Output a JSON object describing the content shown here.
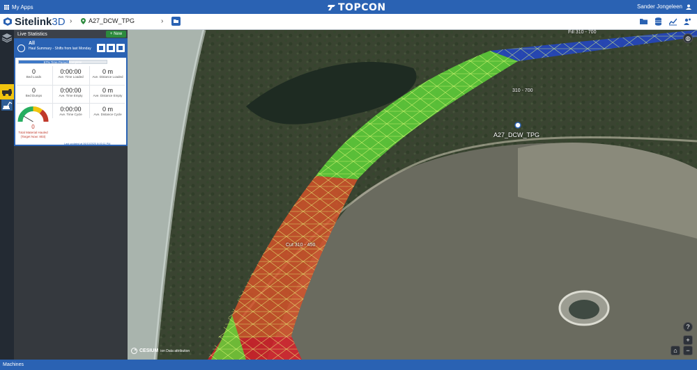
{
  "topbar": {
    "apps_label": "My Apps",
    "brand_logo": "TOPCON",
    "user_name": "Sander Jongeleen"
  },
  "navbar": {
    "app_name": "Sitelink",
    "app_name_suffix": "3D",
    "project_name": "A27_DCW_TPG"
  },
  "panel": {
    "title": "Live Statistics",
    "new_button": "+ New",
    "card": {
      "title": "All",
      "subtitle": "Haul Summary - Shifts from last Monday",
      "progress_label": "57% Time Period Complete",
      "progress": 0.57,
      "stats": [
        {
          "value": "0",
          "label": "Bed Loads"
        },
        {
          "value": "0:00:00",
          "label": "Ave. Time Loaded"
        },
        {
          "value": "0 m",
          "label": "Ave. Distance Loaded"
        },
        {
          "value": "0",
          "label": "Bed Dumps"
        },
        {
          "value": "0:00:00",
          "label": "Ave. Time Empty"
        },
        {
          "value": "0 m",
          "label": "Ave. Distance Empty"
        },
        {
          "value": "0:00:00",
          "label": "Ave. Time Cycle"
        },
        {
          "value": "0 m",
          "label": "Ave. Distance Cycle"
        }
      ],
      "gauge": {
        "value": "0",
        "label": "Total Material Hauled",
        "target": "(Target Now: 803)"
      },
      "updated": "Last updated at 06/10/2020 8:00:11 PM"
    }
  },
  "map": {
    "labels": {
      "fill": "Fill 310 - 700",
      "mid": "310 - 700",
      "site": "A27_DCW_TPG",
      "cut": "Cut 310 - 450"
    },
    "cesium_label": "CESIUM",
    "cesium_credit": "ion   Data attribution"
  },
  "bottombar": {
    "label": "Machines"
  },
  "colors": {
    "primary": "#2a62b3",
    "fill_zone": "#5fd43a",
    "cut_zone": "#d9532a",
    "accent": "#f1c40f"
  }
}
